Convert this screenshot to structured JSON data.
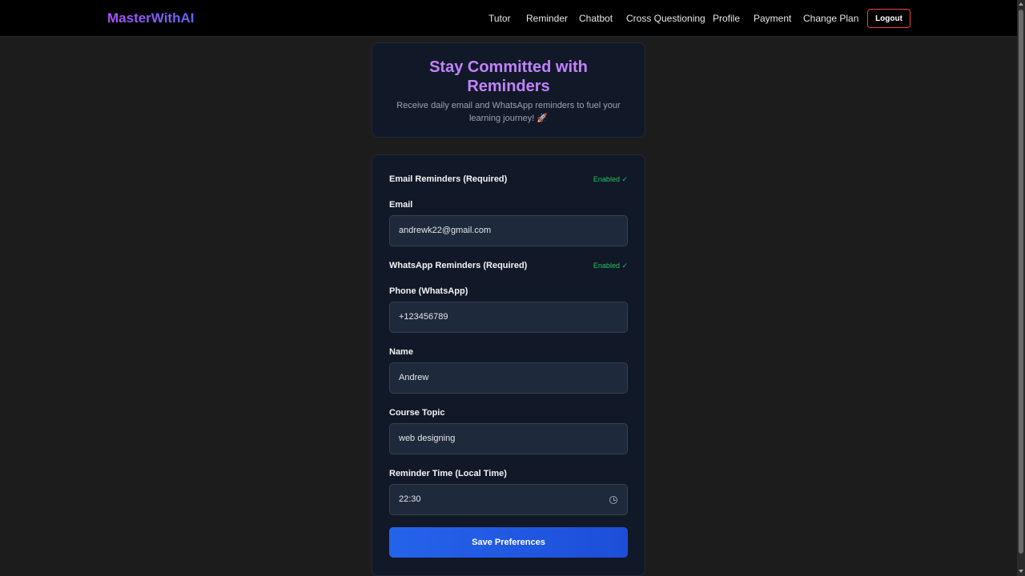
{
  "nav": {
    "brand": "MasterWithAI",
    "links": [
      "Tutor",
      "Reminder",
      "Chatbot",
      "Cross Questioning",
      "Profile",
      "Payment",
      "Change Plan"
    ],
    "logout_label": "Logout"
  },
  "hero": {
    "title": "Stay Committed with Reminders",
    "subtitle": "Receive daily email and WhatsApp reminders to fuel your learning journey! 🚀"
  },
  "form": {
    "email_section": {
      "title": "Email Reminders (Required)",
      "status": "Enabled ✓"
    },
    "email": {
      "label": "Email",
      "value": "andrewk22@gmail.com"
    },
    "whatsapp_section": {
      "title": "WhatsApp Reminders (Required)",
      "status": "Enabled ✓"
    },
    "phone": {
      "label": "Phone (WhatsApp)",
      "value": "+123456789"
    },
    "name": {
      "label": "Name",
      "value": "Andrew"
    },
    "course": {
      "label": "Course Topic",
      "value": "web designing"
    },
    "time": {
      "label": "Reminder Time (Local Time)",
      "value": "22:30",
      "icon": "clock-icon"
    },
    "save_label": "Save Preferences"
  },
  "colors": {
    "accent_purple": "#c084fc",
    "status_green": "#22c55e",
    "logout_border": "#ef4444",
    "primary_button": "#2563eb"
  }
}
